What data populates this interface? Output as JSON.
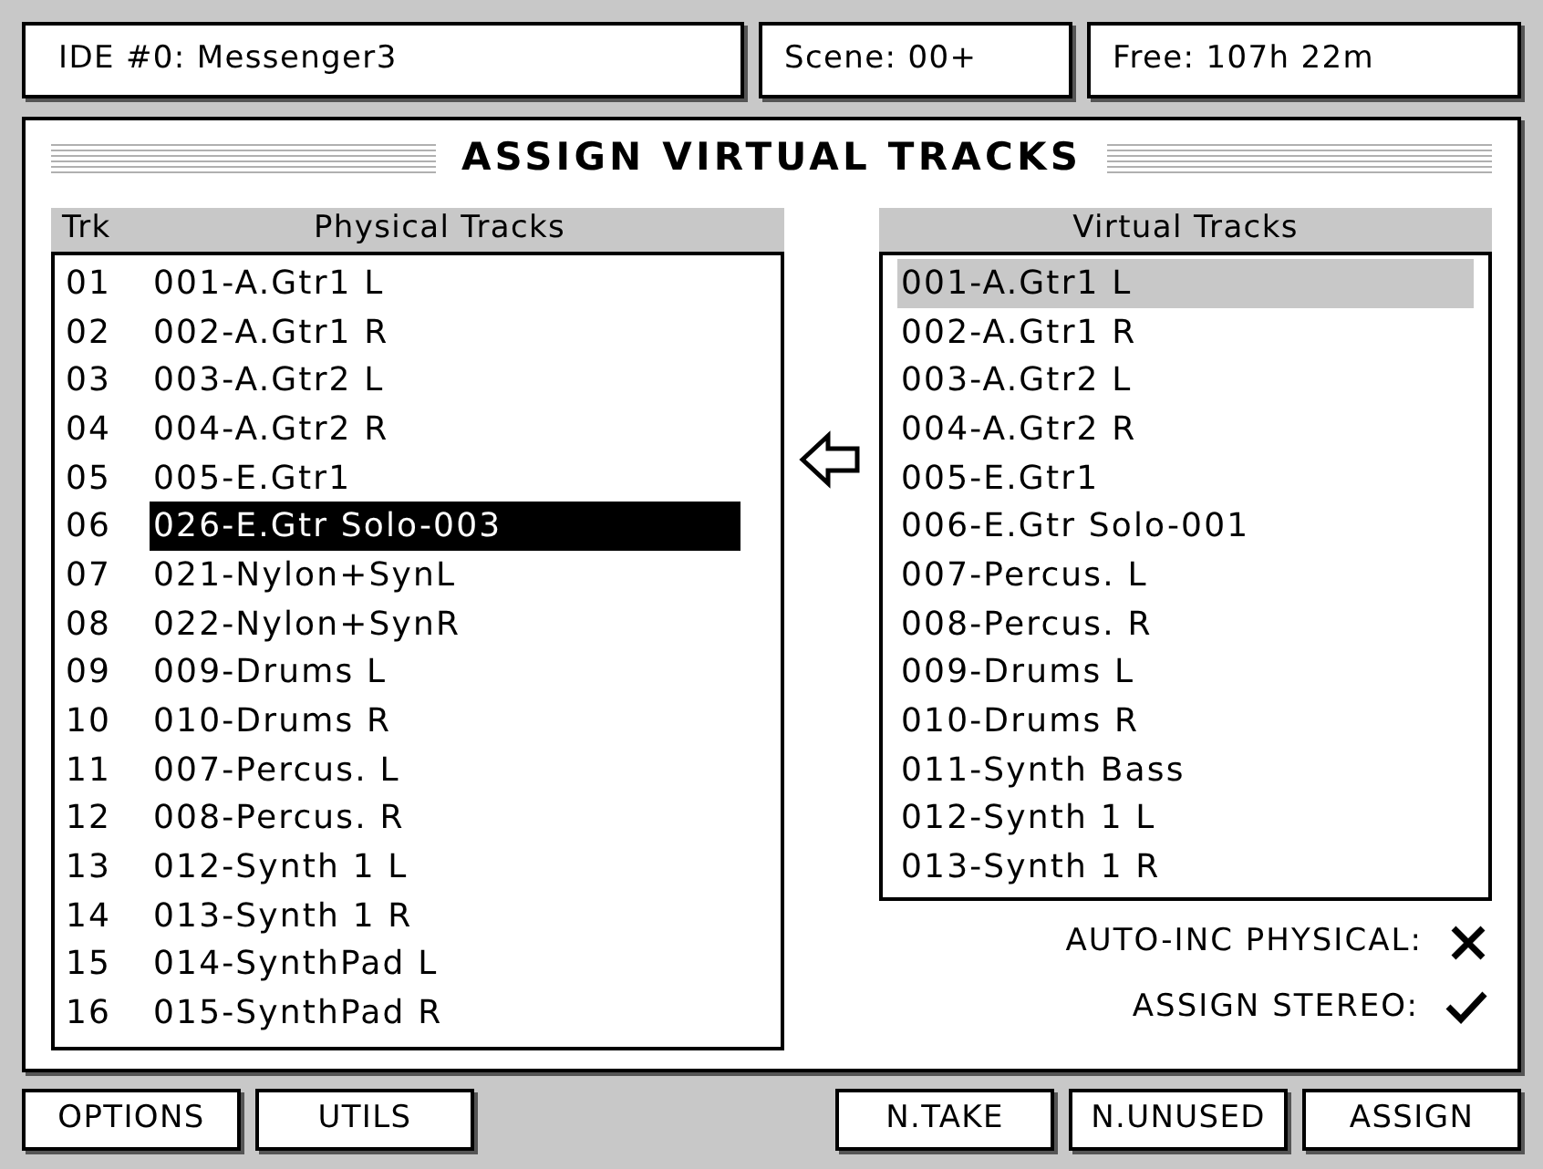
{
  "header": {
    "project": "IDE #0: Messenger3",
    "scene": "Scene: 00+",
    "free": "Free: 107h 22m"
  },
  "title": "ASSIGN VIRTUAL TRACKS",
  "physical": {
    "columns": [
      "Trk",
      "Physical Tracks"
    ],
    "rows": [
      {
        "trk": "01",
        "name": "001-A.Gtr1 L",
        "selected": false
      },
      {
        "trk": "02",
        "name": "002-A.Gtr1 R",
        "selected": false
      },
      {
        "trk": "03",
        "name": "003-A.Gtr2 L",
        "selected": false
      },
      {
        "trk": "04",
        "name": "004-A.Gtr2 R",
        "selected": false
      },
      {
        "trk": "05",
        "name": "005-E.Gtr1",
        "selected": false
      },
      {
        "trk": "06",
        "name": "026-E.Gtr Solo-003",
        "selected": true
      },
      {
        "trk": "07",
        "name": "021-Nylon+SynL",
        "selected": false
      },
      {
        "trk": "08",
        "name": "022-Nylon+SynR",
        "selected": false
      },
      {
        "trk": "09",
        "name": "009-Drums L",
        "selected": false
      },
      {
        "trk": "10",
        "name": "010-Drums R",
        "selected": false
      },
      {
        "trk": "11",
        "name": "007-Percus. L",
        "selected": false
      },
      {
        "trk": "12",
        "name": "008-Percus. R",
        "selected": false
      },
      {
        "trk": "13",
        "name": "012-Synth 1 L",
        "selected": false
      },
      {
        "trk": "14",
        "name": "013-Synth 1 R",
        "selected": false
      },
      {
        "trk": "15",
        "name": "014-SynthPad L",
        "selected": false
      },
      {
        "trk": "16",
        "name": "015-SynthPad R",
        "selected": false
      }
    ]
  },
  "virtual": {
    "heading": "Virtual Tracks",
    "rows": [
      {
        "name": "001-A.Gtr1 L",
        "selected": true
      },
      {
        "name": "002-A.Gtr1 R",
        "selected": false
      },
      {
        "name": "003-A.Gtr2 L",
        "selected": false
      },
      {
        "name": "004-A.Gtr2 R",
        "selected": false
      },
      {
        "name": "005-E.Gtr1",
        "selected": false
      },
      {
        "name": "006-E.Gtr Solo-001",
        "selected": false
      },
      {
        "name": "007-Percus. L",
        "selected": false
      },
      {
        "name": "008-Percus. R",
        "selected": false
      },
      {
        "name": "009-Drums L",
        "selected": false
      },
      {
        "name": "010-Drums R",
        "selected": false
      },
      {
        "name": "011-Synth Bass",
        "selected": false
      },
      {
        "name": "012-Synth 1 L",
        "selected": false
      },
      {
        "name": "013-Synth 1 R",
        "selected": false
      }
    ]
  },
  "options": [
    {
      "label": "AUTO-INC PHYSICAL:",
      "checked": false
    },
    {
      "label": "ASSIGN STEREO:",
      "checked": true
    }
  ],
  "buttons_left": [
    "OPTIONS",
    "UTILS"
  ],
  "buttons_right": [
    "N.TAKE",
    "N.UNUSED",
    "ASSIGN"
  ]
}
